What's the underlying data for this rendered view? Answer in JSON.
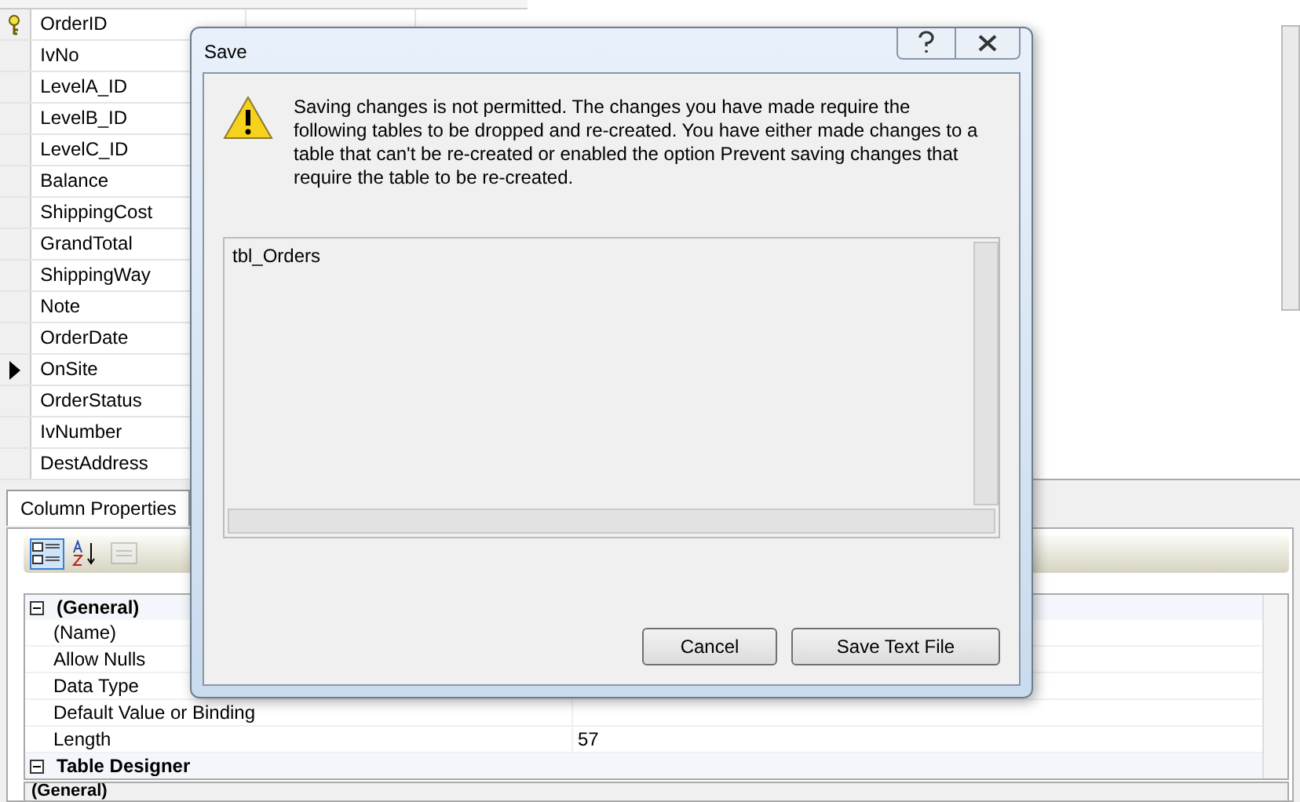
{
  "designer_grid": {
    "rows": [
      {
        "name": "OrderID",
        "primary_key": true,
        "current": false
      },
      {
        "name": "IvNo",
        "primary_key": false,
        "current": false
      },
      {
        "name": "LevelA_ID",
        "primary_key": false,
        "current": false
      },
      {
        "name": "LevelB_ID",
        "primary_key": false,
        "current": false
      },
      {
        "name": "LevelC_ID",
        "primary_key": false,
        "current": false
      },
      {
        "name": "Balance",
        "primary_key": false,
        "current": false
      },
      {
        "name": "ShippingCost",
        "primary_key": false,
        "current": false
      },
      {
        "name": "GrandTotal",
        "primary_key": false,
        "current": false
      },
      {
        "name": "ShippingWay",
        "primary_key": false,
        "current": false
      },
      {
        "name": "Note",
        "primary_key": false,
        "current": false
      },
      {
        "name": "OrderDate",
        "primary_key": false,
        "current": false
      },
      {
        "name": "OnSite",
        "primary_key": false,
        "current": true
      },
      {
        "name": "OrderStatus",
        "primary_key": false,
        "current": false
      },
      {
        "name": "IvNumber",
        "primary_key": false,
        "current": false
      },
      {
        "name": "DestAddress",
        "primary_key": false,
        "current": false
      }
    ]
  },
  "column_properties": {
    "tab": "Column Properties",
    "categories": [
      {
        "name": "(General)",
        "expanded": true,
        "properties": [
          {
            "name": "(Name)"
          },
          {
            "name": "Allow Nulls"
          },
          {
            "name": "Data Type"
          },
          {
            "name": "Default Value or Binding"
          },
          {
            "name": "Length",
            "value": "57"
          }
        ]
      },
      {
        "name": "Table Designer",
        "expanded": true
      }
    ],
    "description": "(General)"
  },
  "dialog": {
    "title": "Save",
    "message": "Saving changes is not permitted. The changes you have made require the following tables to be dropped and re-created. You have either made changes to a table that can't be re-created or enabled the option Prevent saving changes that require the table to be re-created.",
    "tables_list": "tbl_Orders",
    "buttons": [
      "Cancel",
      "Save Text File"
    ]
  }
}
